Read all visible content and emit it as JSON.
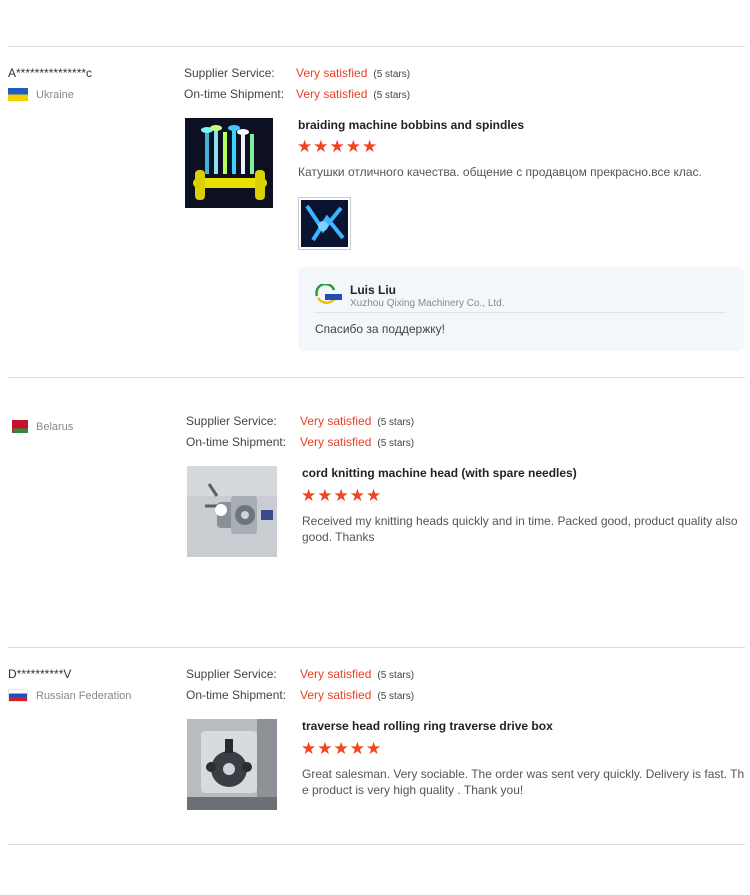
{
  "reviews": [
    {
      "buyer": "A***************c",
      "country": "Ukraine",
      "supplier_label": "Supplier Service:",
      "supplier_value": "Very satisfied",
      "supplier_stars": "(5 stars)",
      "shipment_label": "On-time Shipment:",
      "shipment_value": "Very satisfied",
      "shipment_stars": "(5 stars)",
      "product": "braiding machine bobbins and spindles",
      "stars": "★★★★★",
      "text": "Катушки отличного качества. общение с продавцом прекрасно.все клас.",
      "reply": {
        "name": "Luis Liu",
        "company": "Xuzhou Qixing Machinery Co., Ltd.",
        "text": "Спасибо за поддержку!"
      }
    },
    {
      "buyer": "",
      "country": "Belarus",
      "supplier_label": "Supplier Service:",
      "supplier_value": "Very satisfied",
      "supplier_stars": "(5 stars)",
      "shipment_label": "On-time Shipment:",
      "shipment_value": "Very satisfied",
      "shipment_stars": "(5 stars)",
      "product": "cord knitting machine head (with spare needles)",
      "stars": "★★★★★",
      "text": "Received my knitting heads quickly and in time. Packed good, product quality also good. Thanks"
    },
    {
      "buyer": "D**********V",
      "country": "Russian Federation",
      "supplier_label": "Supplier Service:",
      "supplier_value": "Very satisfied",
      "supplier_stars": "(5 stars)",
      "shipment_label": "On-time Shipment:",
      "shipment_value": "Very satisfied",
      "shipment_stars": "(5 stars)",
      "product": "traverse head rolling ring traverse drive box",
      "stars": "★★★★★",
      "text": "Great salesman. Very sociable. The order was sent very quickly. Delivery is fast. The product is very high quality . Thank you!"
    }
  ],
  "colors": {
    "accent": "#e8402a",
    "star": "#f04422",
    "reply_bg": "#f3f7fb"
  }
}
